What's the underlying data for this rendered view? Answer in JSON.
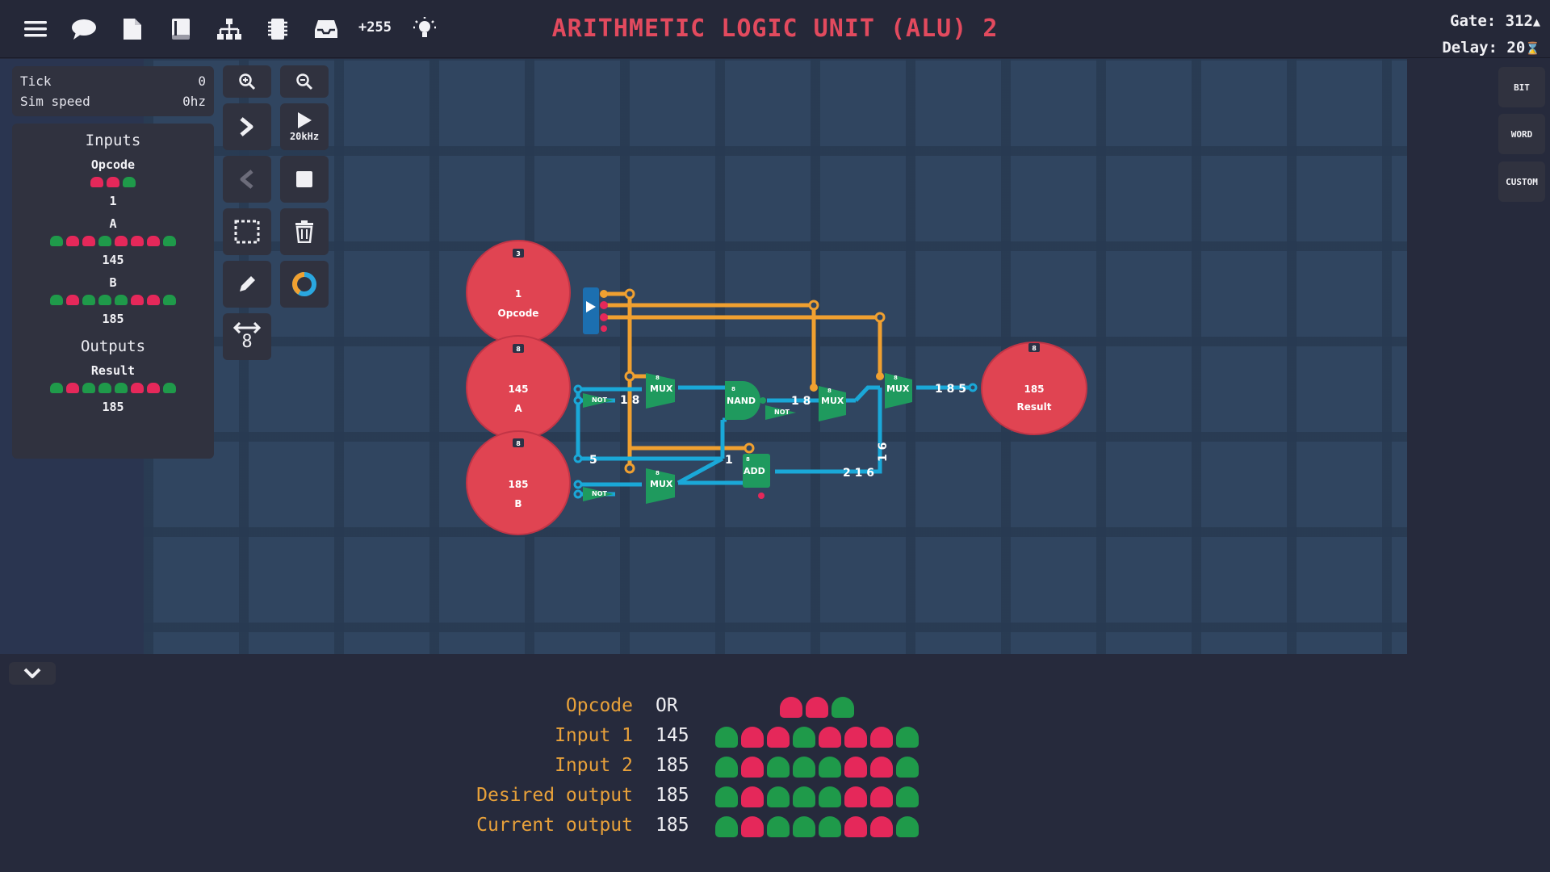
{
  "header": {
    "title": "ARITHMETIC LOGIC UNIT (ALU) 2",
    "scrap_count": "+255",
    "gate_label": "Gate: 312",
    "delay_label": "Delay: 20"
  },
  "sim": {
    "tick_label": "Tick",
    "tick_value": "0",
    "speed_label": "Sim speed",
    "speed_value": "0hz",
    "run_speed": "20kHz",
    "wire_width": "8"
  },
  "inputs_panel": {
    "inputs_title": "Inputs",
    "outputs_title": "Outputs",
    "inputs": [
      {
        "name": "Opcode",
        "value": "1",
        "bits": [
          0,
          0,
          1
        ]
      },
      {
        "name": "A",
        "value": "145",
        "bits": [
          1,
          0,
          0,
          1,
          0,
          0,
          0,
          1
        ]
      },
      {
        "name": "B",
        "value": "185",
        "bits": [
          1,
          0,
          1,
          1,
          1,
          0,
          0,
          1
        ]
      }
    ],
    "outputs": [
      {
        "name": "Result",
        "value": "185",
        "bits": [
          1,
          0,
          1,
          1,
          1,
          0,
          0,
          1
        ]
      }
    ]
  },
  "side_buttons": {
    "bit": "BIT",
    "word": "WORD",
    "custom": "CUSTOM"
  },
  "circuit": {
    "nodes": {
      "opcode": {
        "width": "3",
        "value": "1",
        "name": "Opcode"
      },
      "a": {
        "width": "8",
        "value": "145",
        "name": "A"
      },
      "b": {
        "width": "8",
        "value": "185",
        "name": "B"
      },
      "result": {
        "width": "8",
        "value": "185",
        "name": "Result"
      }
    },
    "gates": {
      "not1": "NOT",
      "not2": "NOT",
      "not3": "NOT",
      "mux1": "MUX",
      "mux2": "MUX",
      "mux3": "MUX",
      "mux4": "MUX",
      "nand": "NAND",
      "add": "ADD",
      "width": "8"
    },
    "wire_values": {
      "w1": "1 8",
      "w2": "1 8",
      "w3": "1 8 5",
      "w4": "5",
      "w5": "1",
      "w6": "2 1 6",
      "w7": "1 6"
    }
  },
  "test_table": {
    "rows": [
      {
        "label": "Opcode",
        "value": "OR",
        "bits": [
          0,
          0,
          1
        ]
      },
      {
        "label": "Input 1",
        "value": "145",
        "bits": [
          1,
          0,
          0,
          1,
          0,
          0,
          0,
          1
        ]
      },
      {
        "label": "Input 2",
        "value": "185",
        "bits": [
          1,
          0,
          1,
          1,
          1,
          0,
          0,
          1
        ]
      },
      {
        "label": "Desired output",
        "value": "185",
        "bits": [
          1,
          0,
          1,
          1,
          1,
          0,
          0,
          1
        ]
      },
      {
        "label": "Current output",
        "value": "185",
        "bits": [
          1,
          0,
          1,
          1,
          1,
          0,
          0,
          1
        ]
      }
    ]
  },
  "colors": {
    "bit_on": "#1f9a4a",
    "bit_off": "#e5285a",
    "wire_orange": "#f0a030",
    "wire_blue": "#1aa8d8",
    "node_red": "#e04452",
    "gate_green": "#1f9a5e",
    "title_red": "#e24a5e"
  }
}
